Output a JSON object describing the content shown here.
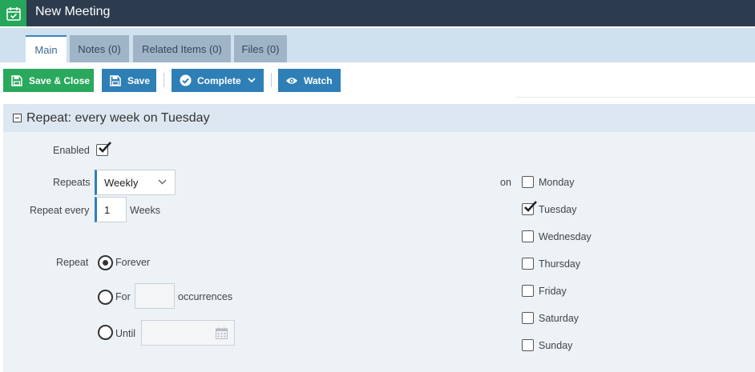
{
  "window": {
    "title": "New Meeting",
    "icon": "calendar-check-icon"
  },
  "tabs": [
    {
      "label": "Main",
      "active": true
    },
    {
      "label": "Notes (0)",
      "active": false
    },
    {
      "label": "Related Items (0)",
      "active": false
    },
    {
      "label": "Files (0)",
      "active": false
    }
  ],
  "toolbar": {
    "save_close_label": "Save & Close",
    "save_label": "Save",
    "complete_label": "Complete",
    "watch_label": "Watch"
  },
  "repeat_panel": {
    "title": "Repeat: every week on Tuesday",
    "enabled_label": "Enabled",
    "enabled": true,
    "repeats_label": "Repeats",
    "repeats_value": "Weekly",
    "repeat_every_label": "Repeat every",
    "repeat_every_value": "1",
    "repeat_every_unit": "Weeks",
    "repeat_label": "Repeat",
    "forever_label": "Forever",
    "for_label": "For",
    "occurrences_label": "occurrences",
    "until_label": "Until",
    "selected_option": "Forever",
    "on_label": "on",
    "days": [
      {
        "label": "Monday",
        "checked": false
      },
      {
        "label": "Tuesday",
        "checked": true
      },
      {
        "label": "Wednesday",
        "checked": false
      },
      {
        "label": "Thursday",
        "checked": false
      },
      {
        "label": "Friday",
        "checked": false
      },
      {
        "label": "Saturday",
        "checked": false
      },
      {
        "label": "Sunday",
        "checked": false
      }
    ]
  },
  "colors": {
    "titlebar": "#2d3b4e",
    "accent_green": "#2aa85d",
    "accent_blue": "#2f7fb7",
    "tabstrip": "#cfe0ee",
    "panel": "#edf2f7"
  }
}
